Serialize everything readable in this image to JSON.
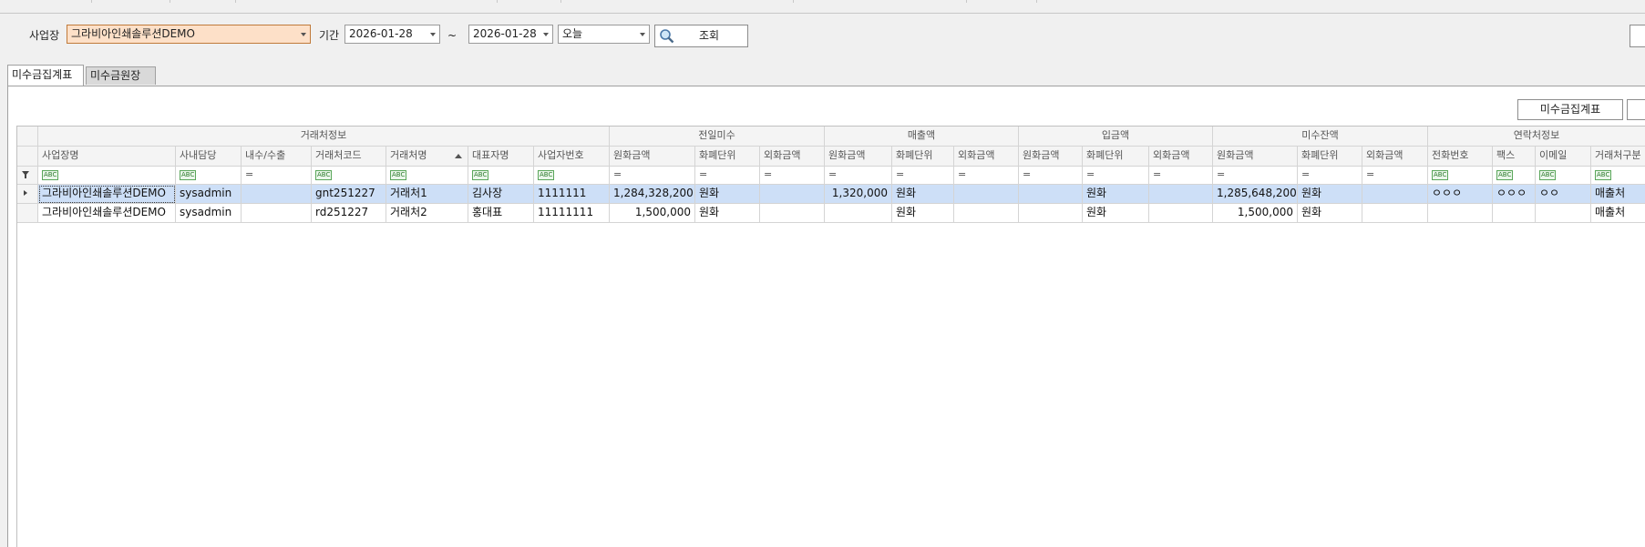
{
  "filter": {
    "site_label": "사업장",
    "site_value": "그라비아인쇄솔루션DEMO",
    "period_label": "기간",
    "date_from": "2026-01-28",
    "tilde": "~",
    "date_to": "2026-01-28",
    "range_value": "오늘",
    "search_label": "조회"
  },
  "tabs": [
    "미수금집계표",
    "미수금원장"
  ],
  "actions": {
    "summary_button": "미수금집계표"
  },
  "grid": {
    "groups": [
      "거래처정보",
      "전일미수",
      "매출액",
      "입금액",
      "미수잔액",
      "연락처정보"
    ],
    "columns": [
      "사업장명",
      "사내담당",
      "내수/수출",
      "거래처코드",
      "거래처명",
      "대표자명",
      "사업자번호",
      "원화금액",
      "화폐단위",
      "외화금액",
      "원화금액",
      "화폐단위",
      "외화금액",
      "원화금액",
      "화폐단위",
      "외화금액",
      "원화금액",
      "화폐단위",
      "외화금액",
      "전화번호",
      "팩스",
      "이메일",
      "거래처구분"
    ],
    "filter_text_icon": "ABC",
    "filter_eq_icon": "=",
    "rows": [
      [
        "그라비아인쇄솔루션DEMO",
        "sysadmin",
        "",
        "gnt251227",
        "거래처1",
        "김사장",
        "1111111",
        "1,284,328,200",
        "원화",
        "",
        "1,320,000",
        "원화",
        "",
        "",
        "원화",
        "",
        "1,285,648,200",
        "원화",
        "",
        "ㅇㅇㅇ",
        "ㅇㅇㅇ",
        "ㅇㅇ",
        "매출처"
      ],
      [
        "그라비아인쇄솔루션DEMO",
        "sysadmin",
        "",
        "rd251227",
        "거래처2",
        "홍대표",
        "11111111",
        "1,500,000",
        "원화",
        "",
        "",
        "원화",
        "",
        "",
        "원화",
        "",
        "1,500,000",
        "원화",
        "",
        "",
        "",
        "",
        "매출처"
      ]
    ]
  }
}
